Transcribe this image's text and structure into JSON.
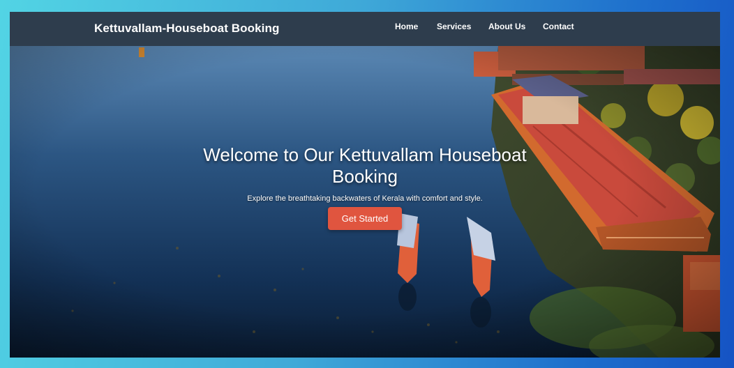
{
  "site": {
    "brand": "Kettuvallam-Houseboat Booking"
  },
  "nav": {
    "items": [
      "Home",
      "Services",
      "About Us",
      "Contact"
    ]
  },
  "hero": {
    "title": "Welcome to Our Kettuvallam Houseboat Booking",
    "subtitle": "Explore the breathtaking backwaters of Kerala with comfort and style.",
    "cta_label": "Get Started",
    "background": "aerial-lake-houseboats-photo"
  },
  "colors": {
    "navbar": "#2e3d4d",
    "cta": "#e0553f",
    "roof": "#c94a3c",
    "water": "#143a5e"
  }
}
